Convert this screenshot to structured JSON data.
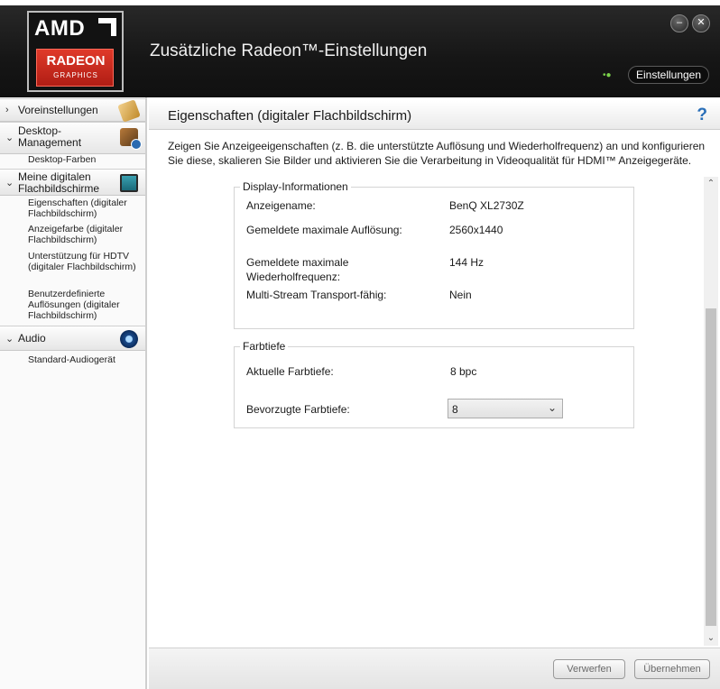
{
  "header": {
    "logo": {
      "brand": "AMD",
      "product": "RADEON",
      "sub": "GRAPHICS"
    },
    "title": "Zusätzliche Radeon™-Einstellungen",
    "settings_button": "Einstellungen",
    "minimize_glyph": "–",
    "close_glyph": "✕",
    "link_glyph": "•●"
  },
  "sidebar": {
    "categories": [
      {
        "label": "Voreinstellungen",
        "chevron": "›",
        "icon": "presets-icon"
      },
      {
        "label": "Desktop-Management",
        "chevron": "⌄",
        "icon": "desktop-management-icon"
      },
      {
        "label": "Meine digitalen Flachbildschirme",
        "chevron": "⌄",
        "icon": "monitor-icon"
      },
      {
        "label": "Audio",
        "chevron": "⌄",
        "icon": "speaker-icon"
      }
    ],
    "desktop_items": [
      "Desktop-Farben"
    ],
    "flatpanel_items": [
      "Eigenschaften (digitaler Flachbildschirm)",
      "Anzeigefarbe (digitaler Flachbildschirm)",
      "Unterstützung für HDTV (digitaler Flachbildschirm)",
      "Benutzerdefinierte Auflösungen (digitaler Flachbildschirm)"
    ],
    "audio_items": [
      "Standard-Audiogerät"
    ]
  },
  "main": {
    "title": "Eigenschaften (digitaler Flachbildschirm)",
    "help_glyph": "?",
    "description": "Zeigen Sie Anzeigeeigenschaften (z. B. die unterstützte Auflösung und Wiederholfrequenz) an und konfigurieren Sie diese, skalieren Sie Bilder und aktivieren Sie die Verarbeitung in Videoqualität für HDMI™ Anzeigegeräte.",
    "display_info": {
      "legend": "Display-Informationen",
      "rows": [
        {
          "label": "Anzeigename:",
          "value": "BenQ XL2730Z"
        },
        {
          "label": "Gemeldete maximale Auflösung:",
          "value": "2560x1440"
        },
        {
          "label": "Gemeldete maximale Wiederholfrequenz:",
          "value": "144 Hz"
        },
        {
          "label": "Multi-Stream Transport-fähig:",
          "value": "Nein"
        }
      ]
    },
    "color_depth": {
      "legend": "Farbtiefe",
      "current_label": "Aktuelle Farbtiefe:",
      "current_value": "8 bpc",
      "preferred_label": "Bevorzugte Farbtiefe:",
      "preferred_value": "8"
    }
  },
  "scrollbar": {
    "up_glyph": "⌃",
    "down_glyph": "⌄"
  },
  "footer": {
    "discard": "Verwerfen",
    "apply": "Übernehmen"
  }
}
